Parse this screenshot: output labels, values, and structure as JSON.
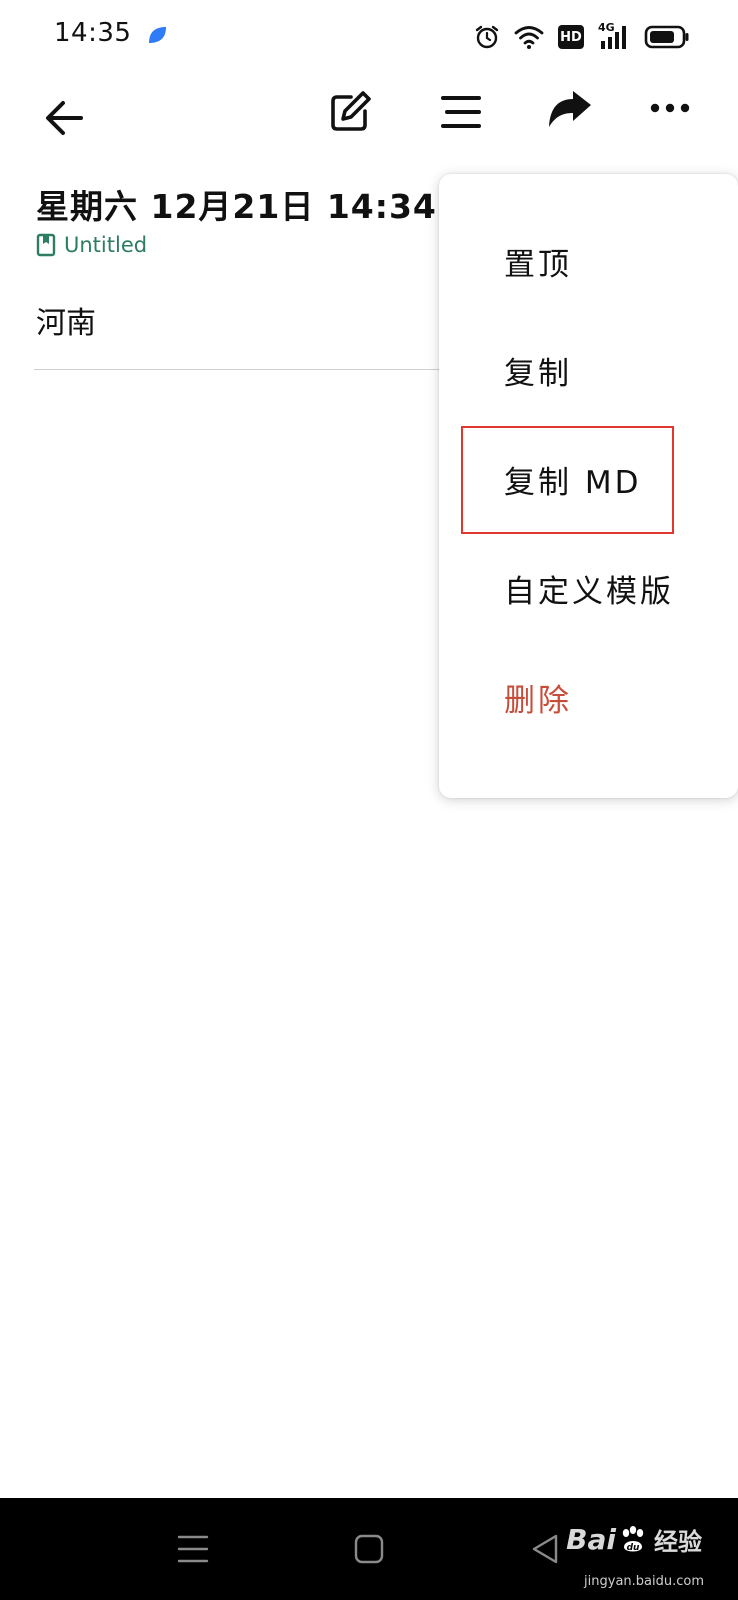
{
  "status_bar": {
    "time": "14:35",
    "app_icon": "blue-leaf-icon",
    "icons": [
      "alarm-icon",
      "wifi-icon",
      "hd-icon",
      "signal-4g-icon",
      "battery-icon"
    ],
    "hd_label": "HD",
    "network_label": "4G"
  },
  "toolbar": {
    "icons": [
      "back-arrow-icon",
      "edit-pencil-icon",
      "menu-lines-icon",
      "share-forward-icon",
      "more-dots-icon"
    ]
  },
  "note": {
    "title": "星期六 12月21日 14:34",
    "notebook": "Untitled",
    "body": "河南"
  },
  "menu": {
    "items": [
      {
        "label": "置顶",
        "style": "normal"
      },
      {
        "label": "复制",
        "style": "normal"
      },
      {
        "label": "复制 MD",
        "style": "highlighted"
      },
      {
        "label": "自定义模版",
        "style": "normal"
      },
      {
        "label": "删除",
        "style": "danger"
      }
    ]
  },
  "navigation": {
    "icons": [
      "recent-apps-icon",
      "home-icon",
      "back-triangle-icon"
    ]
  },
  "watermark": {
    "brand_prefix": "Bai",
    "brand_suffix": "经验",
    "domain": "jingyan.baidu.com"
  },
  "colors": {
    "accent_green": "#2e7d63",
    "danger_red": "#c94b3a",
    "highlight_red": "#e2372f",
    "app_icon_blue": "#2f7cf6"
  }
}
